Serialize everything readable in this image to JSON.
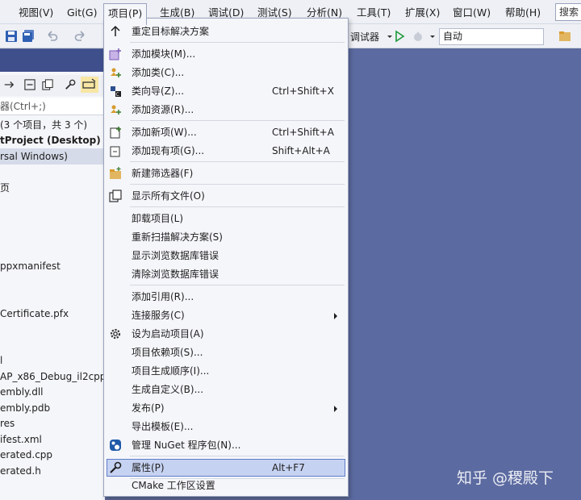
{
  "menubar": {
    "items": [
      "视图(V)",
      "Git(G)",
      "项目(P)",
      "生成(B)",
      "调试(D)",
      "测试(S)",
      "分析(N)",
      "工具(T)",
      "扩展(X)",
      "窗口(W)",
      "帮助(H)"
    ],
    "search_label": "搜索"
  },
  "toolbar": {
    "debugger_label": "调试器",
    "config_value": "自动"
  },
  "solution": {
    "search_placeholder": "器(Ctrl+;)",
    "rows": [
      "(3 个项目，共 3 个)",
      "tProject (Desktop)",
      "rsal Windows)",
      "页",
      "ppxmanifest",
      "Certificate.pfx",
      "l",
      "AP_x86_Debug_il2cpp",
      "embly.dll",
      "embly.pdb",
      "res",
      "ifest.xml",
      "erated.cpp",
      "erated.h"
    ]
  },
  "context_menu": {
    "items": [
      {
        "label": "重定目标解决方案",
        "shortcut": "",
        "icon": "arrow-up-icon"
      },
      {
        "label": "添加模块(M)...",
        "shortcut": "",
        "icon": "add-module-icon"
      },
      {
        "label": "添加类(C)...",
        "shortcut": "",
        "icon": "add-class-icon"
      },
      {
        "label": "类向导(Z)...",
        "shortcut": "Ctrl+Shift+X",
        "icon": "class-wizard-icon"
      },
      {
        "label": "添加资源(R)...",
        "shortcut": "",
        "icon": "add-resource-icon"
      },
      {
        "label": "添加新项(W)...",
        "shortcut": "Ctrl+Shift+A",
        "icon": "add-new-item-icon"
      },
      {
        "label": "添加现有项(G)...",
        "shortcut": "Shift+Alt+A",
        "icon": "add-existing-item-icon"
      },
      {
        "label": "新建筛选器(F)",
        "shortcut": "",
        "icon": "new-filter-folder-icon"
      },
      {
        "label": "显示所有文件(O)",
        "shortcut": "",
        "icon": "show-all-files-icon"
      },
      {
        "label": "卸载项目(L)",
        "shortcut": "",
        "icon": ""
      },
      {
        "label": "重新扫描解决方案(S)",
        "shortcut": "",
        "icon": ""
      },
      {
        "label": "显示浏览数据库错误",
        "shortcut": "",
        "icon": ""
      },
      {
        "label": "清除浏览数据库错误",
        "shortcut": "",
        "icon": ""
      },
      {
        "label": "添加引用(R)...",
        "shortcut": "",
        "icon": ""
      },
      {
        "label": "连接服务(C)",
        "shortcut": "",
        "icon": ""
      },
      {
        "label": "设为启动项目(A)",
        "shortcut": "",
        "icon": "gear-icon"
      },
      {
        "label": "项目依赖项(S)...",
        "shortcut": "",
        "icon": ""
      },
      {
        "label": "项目生成顺序(I)...",
        "shortcut": "",
        "icon": ""
      },
      {
        "label": "生成自定义(B)...",
        "shortcut": "",
        "icon": ""
      },
      {
        "label": "发布(P)",
        "shortcut": "",
        "icon": ""
      },
      {
        "label": "导出模板(E)...",
        "shortcut": "",
        "icon": ""
      },
      {
        "label": "管理 NuGet 程序包(N)...",
        "shortcut": "",
        "icon": "nuget-icon"
      },
      {
        "label": "属性(P)",
        "shortcut": "Alt+F7",
        "icon": "wrench-icon"
      },
      {
        "label": "CMake 工作区设置",
        "shortcut": "",
        "icon": ""
      }
    ]
  },
  "watermark": "知乎 @稷殿下",
  "colors": {
    "accent": "#5f7dc9",
    "highlight": "#c6d2f1",
    "editor_bg": "#5b6aa0"
  }
}
